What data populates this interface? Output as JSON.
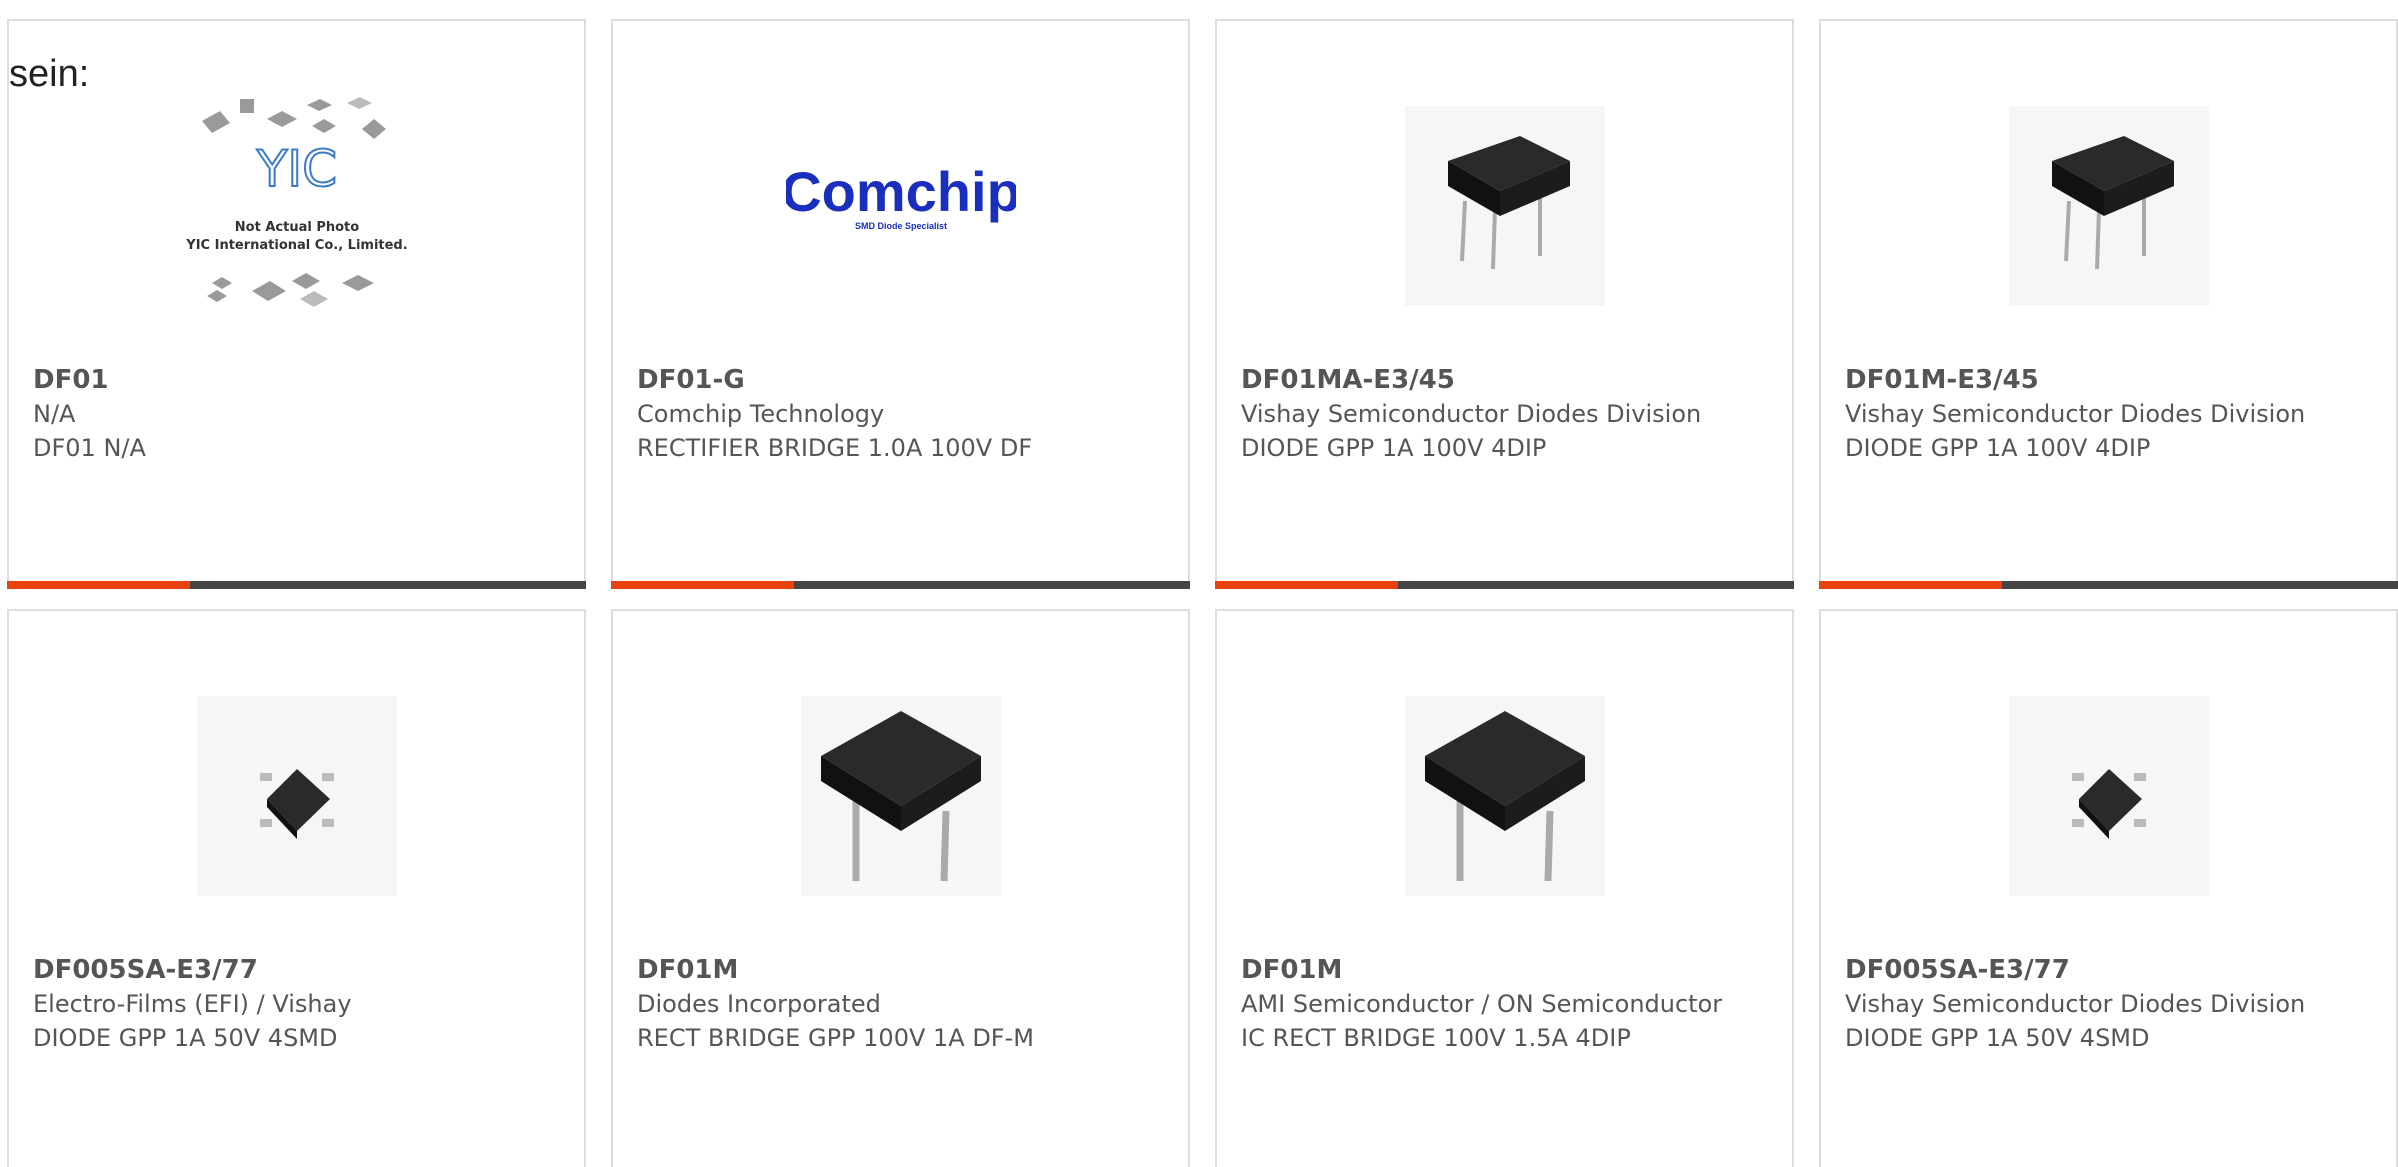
{
  "page": {
    "lead_text": "sein:"
  },
  "colors": {
    "accent": "#e8420e",
    "accent_dark": "#444444",
    "border": "#dddddd",
    "text": "#555555"
  },
  "thumb_labels": {
    "yic_logo": "YIC",
    "yic_caption_line1": "Not Actual Photo",
    "yic_caption_line2": "YIC International Co., Limited.",
    "comchip_logo": "Comchip",
    "comchip_tagline": "SMD Diode Specialist"
  },
  "cards": [
    {
      "part": "DF01",
      "maker": "N/A",
      "desc": "DF01 N/A",
      "image": "yic-placeholder"
    },
    {
      "part": "DF01-G",
      "maker": "Comchip Technology",
      "desc": "RECTIFIER BRIDGE 1.0A 100V DF",
      "image": "comchip-logo"
    },
    {
      "part": "DF01MA-E3/45",
      "maker": "Vishay Semiconductor Diodes Division",
      "desc": "DIODE GPP 1A 100V 4DIP",
      "image": "dip-package"
    },
    {
      "part": "DF01M-E3/45",
      "maker": "Vishay Semiconductor Diodes Division",
      "desc": "DIODE GPP 1A 100V 4DIP",
      "image": "dip-package"
    },
    {
      "part": "DF005SA-E3/77",
      "maker": "Electro-Films (EFI) / Vishay",
      "desc": "DIODE GPP 1A 50V 4SMD",
      "image": "smd-package"
    },
    {
      "part": "DF01M",
      "maker": "Diodes Incorporated",
      "desc": "RECT BRIDGE GPP 100V 1A DF-M",
      "image": "dip-package-large"
    },
    {
      "part": "DF01M",
      "maker": "AMI Semiconductor / ON Semiconductor",
      "desc": "IC RECT BRIDGE 100V 1.5A 4DIP",
      "image": "dip-package-large"
    },
    {
      "part": "DF005SA-E3/77",
      "maker": "Vishay Semiconductor Diodes Division",
      "desc": "DIODE GPP 1A 50V 4SMD",
      "image": "smd-package"
    }
  ]
}
